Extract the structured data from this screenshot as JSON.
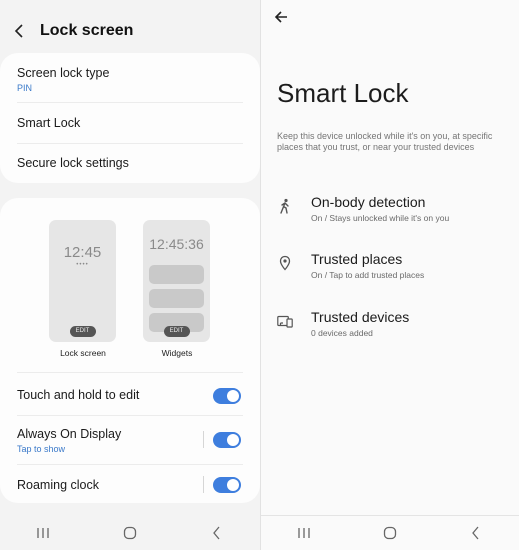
{
  "left": {
    "header": {
      "title": "Lock screen"
    },
    "lock_card": {
      "screen_lock_type": {
        "title": "Screen lock type",
        "value": "PIN"
      },
      "smart_lock": {
        "title": "Smart Lock"
      },
      "secure_lock_settings": {
        "title": "Secure lock settings"
      }
    },
    "previews": {
      "lock": {
        "clock": "12:45",
        "dots": "••••",
        "edit": "EDIT",
        "label": "Lock screen"
      },
      "widgets": {
        "clock": "12:45:36",
        "edit": "EDIT",
        "label": "Widgets"
      }
    },
    "settings": [
      {
        "title": "Touch and hold to edit",
        "sub": "",
        "on": true
      },
      {
        "title": "Always On Display",
        "sub": "Tap to show",
        "on": true
      },
      {
        "title": "Roaming clock",
        "sub": "",
        "on": true
      }
    ]
  },
  "right": {
    "title": "Smart Lock",
    "description": "Keep this device unlocked while it's on you, at specific places that you trust, or near your trusted devices",
    "items": [
      {
        "icon": "walking-person-icon",
        "title": "On-body detection",
        "sub": "On / Stays unlocked while it's on you"
      },
      {
        "icon": "location-pin-icon",
        "title": "Trusted places",
        "sub": "On / Tap to add trusted places"
      },
      {
        "icon": "devices-icon",
        "title": "Trusted devices",
        "sub": "0 devices added"
      }
    ]
  },
  "colors": {
    "accent": "#3e7ede",
    "link": "#3a79c9",
    "toggle_on": "#3e7ede"
  }
}
